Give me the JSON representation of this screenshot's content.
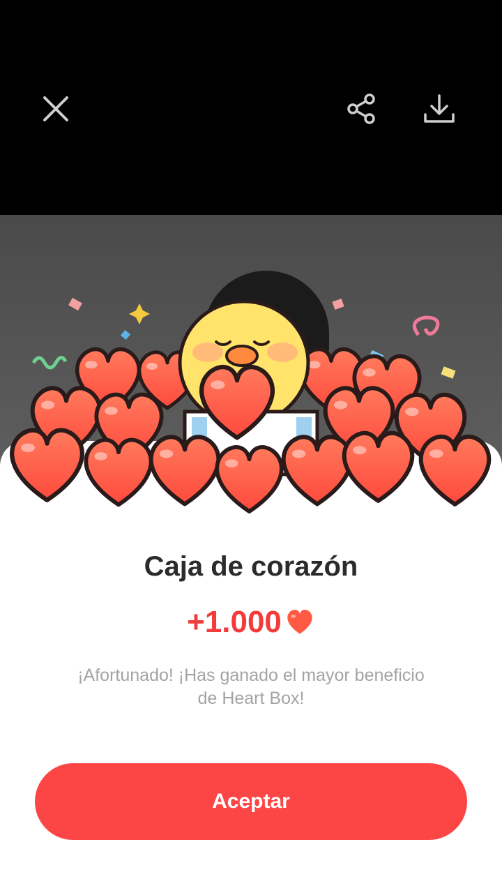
{
  "toolbar": {
    "close_icon": "close-icon",
    "share_icon": "share-icon",
    "download_icon": "download-icon"
  },
  "dialog": {
    "title": "Caja de corazón",
    "reward_amount": "+1.000",
    "reward_icon": "heart-icon",
    "message": "¡Afortunado! ¡Has ganado el mayor beneficio de Heart Box!",
    "accept_label": "Aceptar"
  },
  "colors": {
    "accent": "#fc4545",
    "reward_text": "#f23b3b",
    "title_text": "#2b2b2b",
    "message_text": "#a3a3a3",
    "heart": "#ff5a44",
    "chick": "#ffe36a"
  }
}
